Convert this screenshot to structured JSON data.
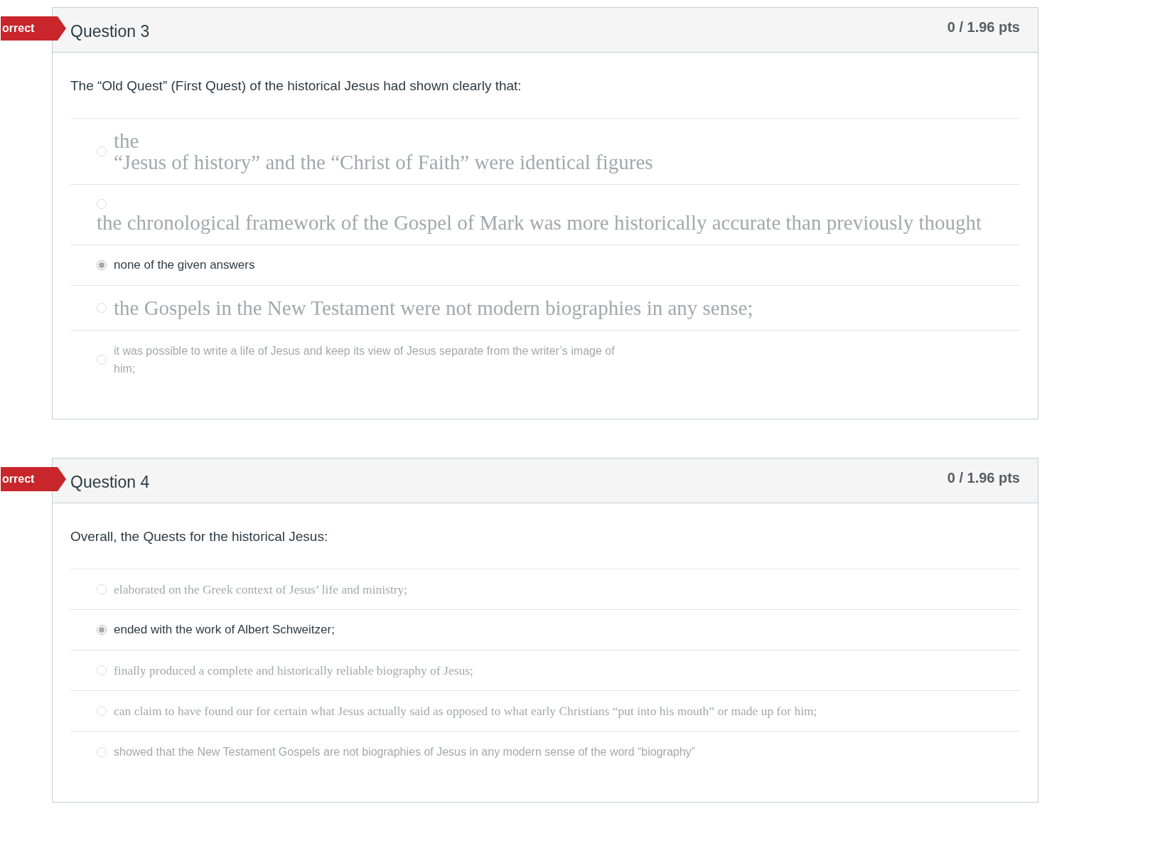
{
  "questions": [
    {
      "badge": "orrect",
      "title": "Question 3",
      "points": "0 / 1.96 pts",
      "text": "The “Old Quest” (First Quest) of the historical Jesus had shown clearly that:",
      "answers": [
        {
          "kind": "serif-large",
          "selected": false,
          "lines": [
            "the",
            "“Jesus of history” and the “Christ of Faith” were identical figures"
          ]
        },
        {
          "kind": "serif-block",
          "selected": false,
          "lines": [
            "the chronological framework of the Gospel of Mark was more historically accurate than previously thought"
          ]
        },
        {
          "kind": "sans",
          "selected": true,
          "lines": [
            "none of the given answers"
          ]
        },
        {
          "kind": "serif-large",
          "selected": false,
          "lines": [
            "the Gospels in the New Testament were not modern biographies in any sense;"
          ]
        },
        {
          "kind": "sans-small",
          "selected": false,
          "lines": [
            "it was possible to write a life of Jesus and keep its view of  Jesus separate from the writer’s image of",
            "him;"
          ]
        }
      ]
    },
    {
      "badge": "orrect",
      "title": "Question 4",
      "points": "0 / 1.96 pts",
      "text": "Overall, the Quests for the historical Jesus:",
      "answers": [
        {
          "kind": "serif",
          "selected": false,
          "lines": [
            "elaborated on the Greek context of Jesus’ life and ministry;"
          ]
        },
        {
          "kind": "sans",
          "selected": true,
          "lines": [
            "ended with the work of Albert Schweitzer;"
          ]
        },
        {
          "kind": "serif",
          "selected": false,
          "lines": [
            "finally produced a complete and historically reliable biography of Jesus;"
          ]
        },
        {
          "kind": "serif",
          "selected": false,
          "lines": [
            "can claim to have found our for certain what Jesus actually said as opposed to what early Christians “put into his mouth” or made up for him;"
          ]
        },
        {
          "kind": "sans-small",
          "selected": false,
          "lines": [
            "showed that the New Testament Gospels are not biographies of Jesus in any modern sense of the word “biography”"
          ]
        }
      ]
    }
  ]
}
